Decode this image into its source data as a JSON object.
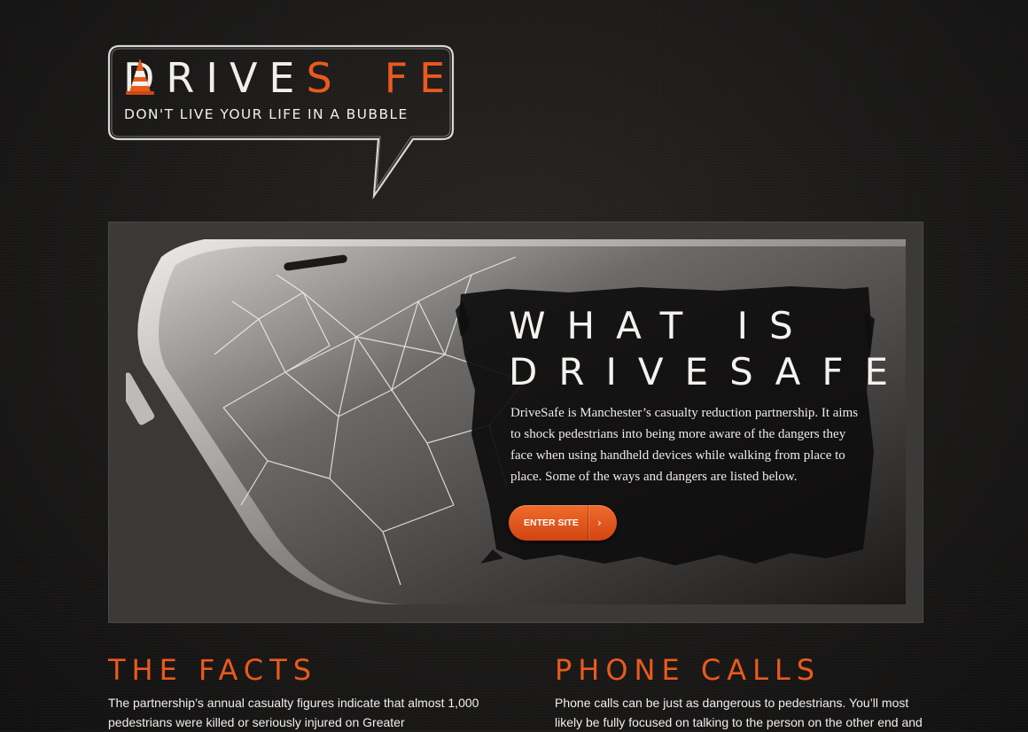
{
  "logo": {
    "word_left": "DRIVE",
    "word_s": "S",
    "word_right": "FE",
    "tagline": "DON'T LIVE YOUR LIFE IN A BUBBLE",
    "cone_icon": "traffic-cone-icon"
  },
  "hero": {
    "title_line1": "WHAT IS",
    "title_line2": "DRIVESAFE",
    "body": "DriveSafe is Manchester’s casualty reduction partnership. It aims to shock pedestrians into being more aware of the dangers they face when using handheld devices while walking from place to place. Some of the ways and dangers are listed below.",
    "button_label": "ENTER SITE",
    "button_icon": "chevron-right-icon"
  },
  "sections": [
    {
      "title": "THE FACTS",
      "text": "The partnership’s annual casualty figures indicate that almost 1,000 pedestrians were killed or seriously injured on Greater"
    },
    {
      "title": "PHONE CALLS",
      "text": "Phone calls can be just as dangerous to pedestrians. You’ll most likely be fully focused on talking to the person on the other end and"
    }
  ],
  "colors": {
    "accent": "#ea5a1c",
    "background": "#1b1a19",
    "text": "#f0efec"
  }
}
